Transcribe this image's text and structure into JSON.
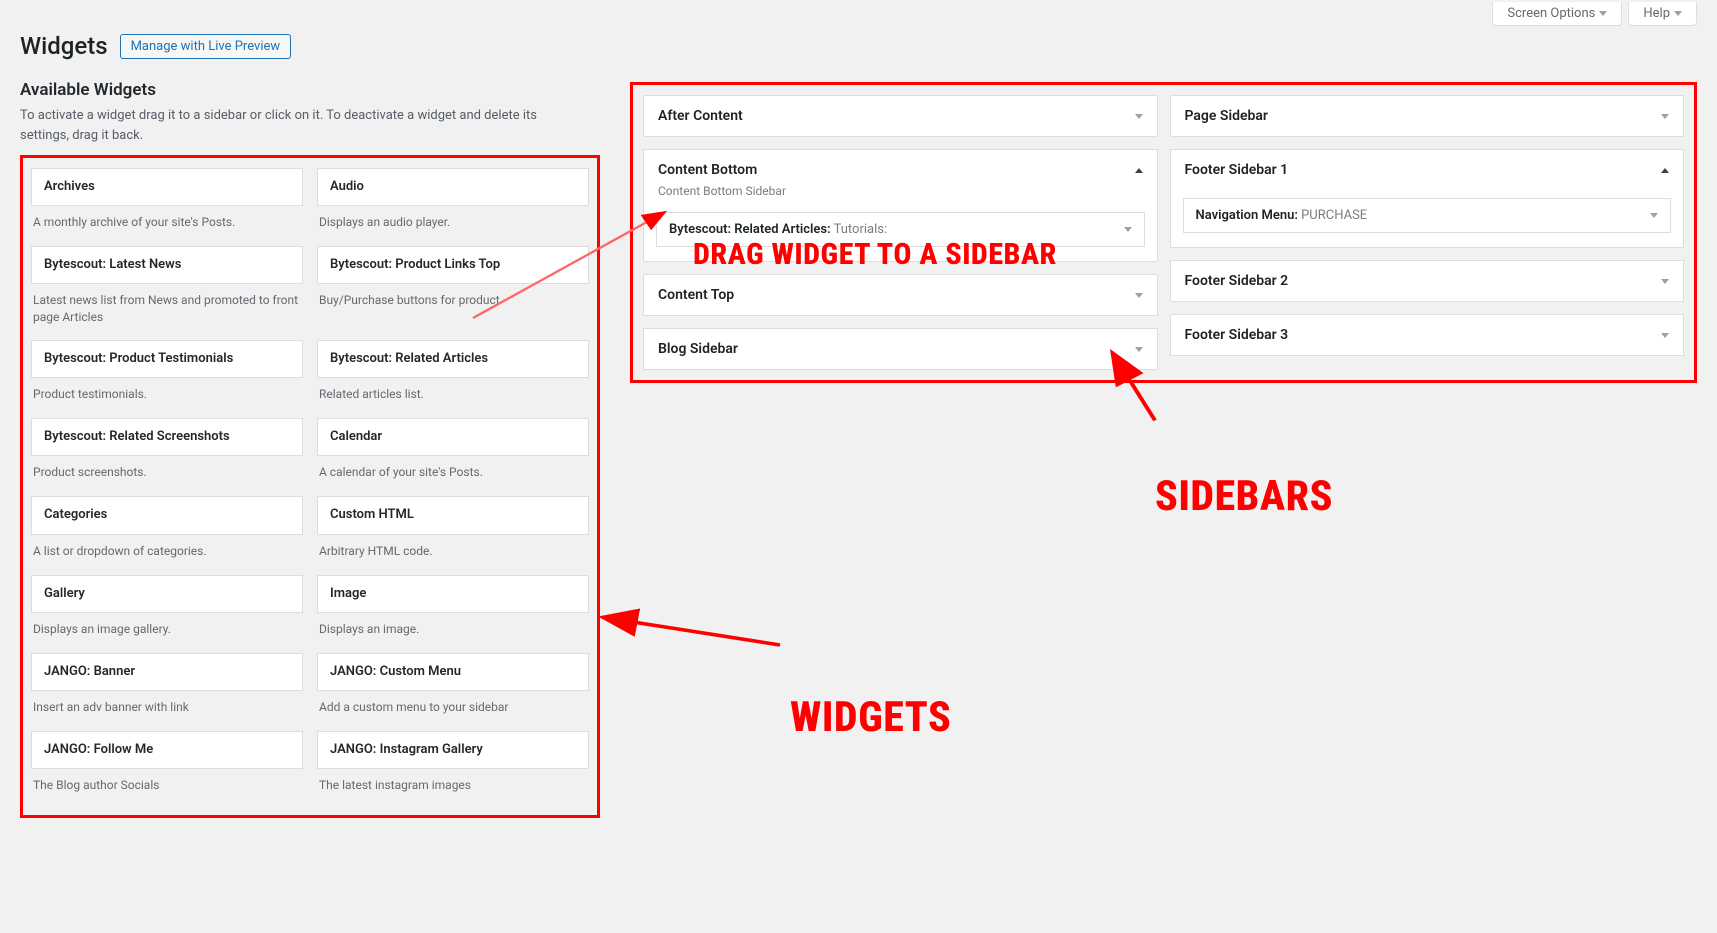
{
  "top": {
    "screen_options": "Screen Options",
    "help": "Help"
  },
  "header": {
    "title": "Widgets",
    "live_preview": "Manage with Live Preview"
  },
  "available": {
    "title": "Available Widgets",
    "description": "To activate a widget drag it to a sidebar or click on it. To deactivate a widget and delete its settings, drag it back."
  },
  "widgets": [
    {
      "name": "Archives",
      "desc": "A monthly archive of your site's Posts."
    },
    {
      "name": "Audio",
      "desc": "Displays an audio player."
    },
    {
      "name": "Bytescout: Latest News",
      "desc": "Latest news list from News and promoted to front page Articles"
    },
    {
      "name": "Bytescout: Product Links Top",
      "desc": "Buy/Purchase buttons for product"
    },
    {
      "name": "Bytescout: Product Testimonials",
      "desc": "Product testimonials."
    },
    {
      "name": "Bytescout: Related Articles",
      "desc": "Related articles list."
    },
    {
      "name": "Bytescout: Related Screenshots",
      "desc": "Product screenshots."
    },
    {
      "name": "Calendar",
      "desc": "A calendar of your site's Posts."
    },
    {
      "name": "Categories",
      "desc": "A list or dropdown of categories."
    },
    {
      "name": "Custom HTML",
      "desc": "Arbitrary HTML code."
    },
    {
      "name": "Gallery",
      "desc": "Displays an image gallery."
    },
    {
      "name": "Image",
      "desc": "Displays an image."
    },
    {
      "name": "JANGO: Banner",
      "desc": "Insert an adv banner with link"
    },
    {
      "name": "JANGO: Custom Menu",
      "desc": "Add a custom menu to your sidebar"
    },
    {
      "name": "JANGO: Follow Me",
      "desc": "The Blog author Socials"
    },
    {
      "name": "JANGO: Instagram Gallery",
      "desc": "The latest instagram images"
    }
  ],
  "sidebars": {
    "left_col": [
      {
        "title": "After Content",
        "expanded": false
      },
      {
        "title": "Content Bottom",
        "expanded": true,
        "sub": "Content Bottom Sidebar",
        "items": [
          {
            "name": "Bytescout: Related Articles:",
            "suffix": " Tutorials:"
          }
        ]
      },
      {
        "title": "Content Top",
        "expanded": false
      },
      {
        "title": "Blog Sidebar",
        "expanded": false
      }
    ],
    "right_col": [
      {
        "title": "Page Sidebar",
        "expanded": false
      },
      {
        "title": "Footer Sidebar 1",
        "expanded": true,
        "items": [
          {
            "name": "Navigation Menu:",
            "suffix": " PURCHASE"
          }
        ]
      },
      {
        "title": "Footer Sidebar 2",
        "expanded": false
      },
      {
        "title": "Footer Sidebar 3",
        "expanded": false
      }
    ]
  },
  "anno": {
    "drag": "DRAG WIDGET TO A SIDEBAR",
    "sidebars": "SIDEBARS",
    "widgets": "WIDGETS"
  }
}
